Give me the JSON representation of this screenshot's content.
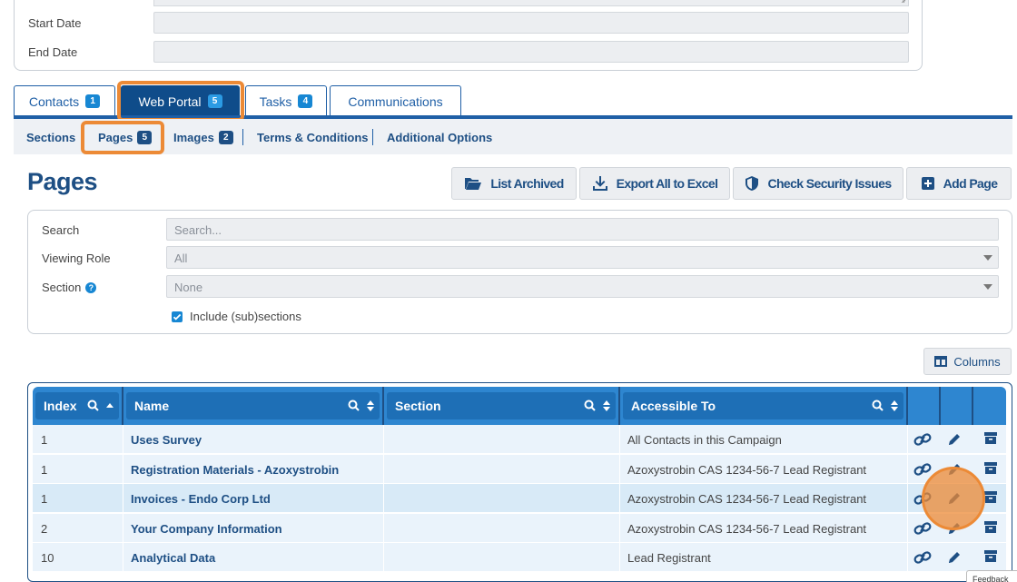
{
  "form": {
    "start_date_label": "Start Date",
    "end_date_label": "End Date"
  },
  "tabs": [
    {
      "label": "Contacts",
      "count": "1"
    },
    {
      "label": "Web Portal",
      "count": "5"
    },
    {
      "label": "Tasks",
      "count": "4"
    },
    {
      "label": "Communications",
      "count": ""
    }
  ],
  "subtabs": [
    {
      "label": "Sections",
      "count": ""
    },
    {
      "label": "Pages",
      "count": "5"
    },
    {
      "label": "Images",
      "count": "2"
    },
    {
      "label": "Terms & Conditions",
      "count": ""
    },
    {
      "label": "Additional Options",
      "count": ""
    }
  ],
  "page": {
    "title": "Pages"
  },
  "toolbar": {
    "list_archived": "List Archived",
    "export_excel": "Export All to Excel",
    "check_security": "Check Security Issues",
    "add_page": "Add Page"
  },
  "filters": {
    "search_label": "Search",
    "search_placeholder": "Search...",
    "role_label": "Viewing Role",
    "role_value": "All",
    "section_label": "Section",
    "section_value": "None",
    "include_label": "Include (sub)sections",
    "include_checked": true
  },
  "columns_button": "Columns",
  "table": {
    "headers": {
      "index": "Index",
      "name": "Name",
      "section": "Section",
      "accessible": "Accessible To"
    },
    "rows": [
      {
        "index": "1",
        "name": "Uses Survey",
        "section": "",
        "accessible": "All Contacts in this Campaign"
      },
      {
        "index": "1",
        "name": "Registration Materials - Azoxystrobin",
        "section": "",
        "accessible": "Azoxystrobin CAS 1234-56-7 Lead Registrant"
      },
      {
        "index": "1",
        "name": "Invoices - Endo Corp Ltd",
        "section": "",
        "accessible": "Azoxystrobin CAS 1234-56-7 Lead Registrant"
      },
      {
        "index": "2",
        "name": "Your Company Information",
        "section": "",
        "accessible": "Azoxystrobin CAS 1234-56-7 Lead Registrant"
      },
      {
        "index": "10",
        "name": "Analytical Data",
        "section": "",
        "accessible": "Lead Registrant"
      }
    ]
  },
  "feedback_label": "Feedback",
  "colors": {
    "primary": "#1e4f84",
    "accent": "#1787d3",
    "highlight": "#ec8a36",
    "header": "#2e86d0"
  }
}
